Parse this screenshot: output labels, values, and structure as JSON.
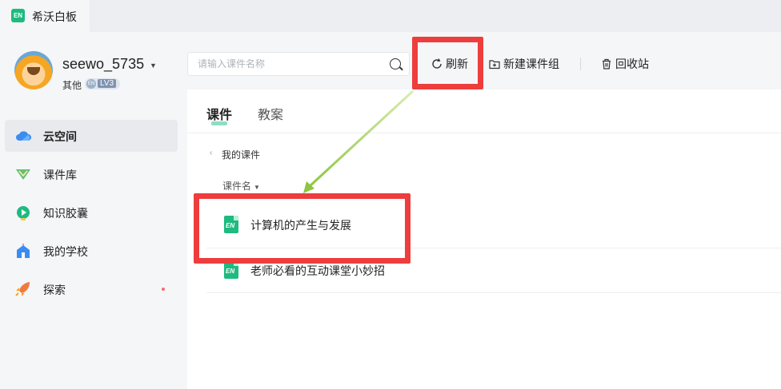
{
  "app": {
    "title": "希沃白板",
    "logo_text": "EN"
  },
  "user": {
    "name": "seewo_5735",
    "subtitle": "其他",
    "level_prefix": "EN",
    "level": "LV3"
  },
  "sidebar": {
    "items": [
      {
        "label": "云空间",
        "icon": "cloud-icon",
        "active": true
      },
      {
        "label": "课件库",
        "icon": "courseware-library-icon"
      },
      {
        "label": "知识胶囊",
        "icon": "knowledge-capsule-icon"
      },
      {
        "label": "我的学校",
        "icon": "school-icon"
      },
      {
        "label": "探索",
        "icon": "rocket-icon",
        "has_dot": true
      }
    ]
  },
  "toolbar": {
    "search_placeholder": "请输入课件名称",
    "refresh_label": "刷新",
    "new_group_label": "新建课件组",
    "recycle_label": "回收站"
  },
  "tabs": {
    "course": "课件",
    "plan": "教案"
  },
  "breadcrumb": {
    "label": "我的课件"
  },
  "list": {
    "column_header": "课件名",
    "items": [
      {
        "name": "计算机的产生与发展",
        "icon_text": "EN"
      },
      {
        "name": "老师必看的互动课堂小妙招",
        "icon_text": "EN"
      }
    ]
  },
  "colors": {
    "accent": "#1dbb7f",
    "highlight": "#ee3d3d",
    "arrow": "#8dc63f"
  }
}
